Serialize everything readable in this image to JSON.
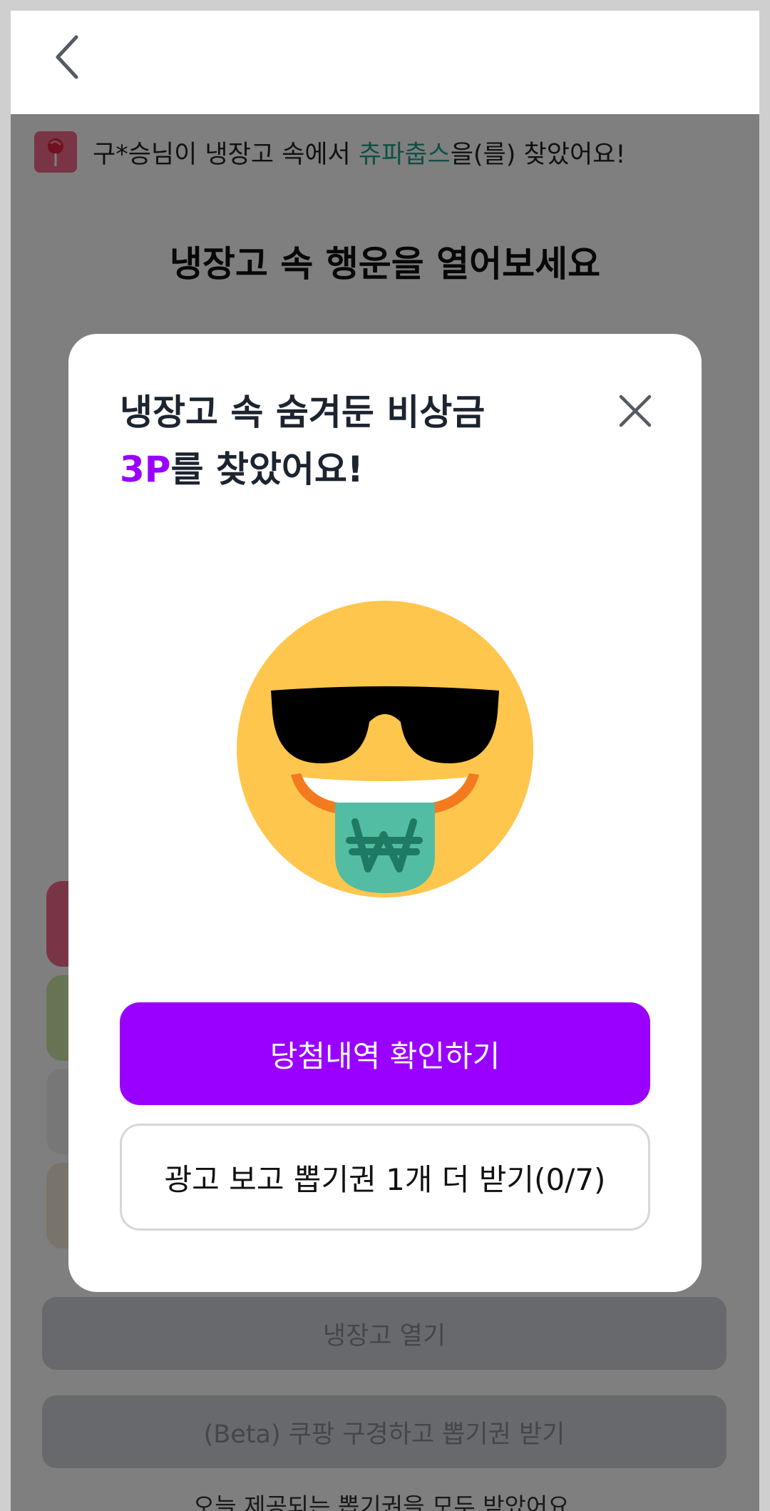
{
  "header": {
    "back_icon": "chevron-left-icon"
  },
  "ticker": {
    "icon": "lollipop-icon",
    "prefix": "구*승님이 냉장고 속에서 ",
    "item": "츄파춥스",
    "suffix": "을(를) 찾았어요!",
    "highlight_color": "#1ea08a"
  },
  "page": {
    "title": "냉장고 속 행운을 열어보세요",
    "open_button": "냉장고 열기",
    "beta_button": "(Beta) 쿠팡 구경하고 뽑기권 받기",
    "notice": "오늘 제공되는 뽑기권을 모두 받았어요."
  },
  "modal": {
    "title_line1": "냉장고 속 숨겨둔 비상금",
    "points": "3P",
    "title_line2_suffix": "를 찾았어요!",
    "close_icon": "close-icon",
    "emoji": "sunglasses-money-tongue-emoji",
    "primary_button": "당첨내역 확인하기",
    "secondary_button": "광고 보고 뽑기권 1개 더 받기(0/7)"
  },
  "colors": {
    "accent": "#9900ff",
    "overlay": "rgba(0,0,0,0.5)"
  }
}
